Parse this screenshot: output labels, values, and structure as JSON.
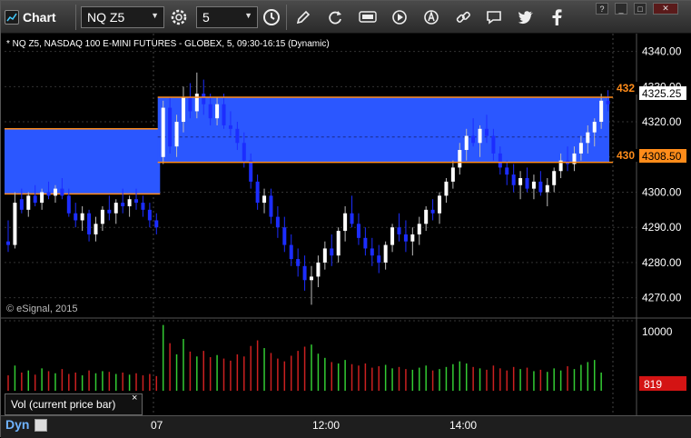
{
  "window": {
    "title": "Chart",
    "controls": [
      "?",
      "_",
      "□",
      "✕"
    ]
  },
  "toolbar": {
    "symbol": "NQ Z5",
    "interval": "5",
    "icons": [
      "settings-gear-icon",
      "clock-icon",
      "draw-pencil-icon",
      "refresh-icon",
      "get-data-icon",
      "play-icon",
      "alert-icon",
      "link-icon",
      "chat-icon",
      "twitter-icon",
      "facebook-icon"
    ]
  },
  "chart": {
    "header": "* NQ Z5, NASDAQ 100 E-MINI FUTURES - GLOBEX, 5, 09:30-16:15 (Dynamic)",
    "copyright": "© eSignal, 2015",
    "price_marker_last": "4325.25",
    "price_marker_top": "432",
    "price_marker_bottom_left": "430",
    "price_marker_bottom": "4308.50",
    "vol_marker": "819",
    "vol_axis_label": "10000",
    "vol_tab_label": "Vol (current price bar)",
    "vol_close": "×",
    "dyn_label": "Dyn",
    "colors": {
      "up": "#ffffff",
      "down": "#1c2dff",
      "band": "#2b57ff",
      "level_line": "#ff8c1a",
      "vol_up": "#33cc33",
      "vol_down": "#cc2020",
      "price_marker_bg": "#ffffff",
      "level_marker_bg": "#ff8c1a",
      "vol_marker_bg": "#d41414"
    }
  },
  "chart_data": {
    "type": "candlestick",
    "title": "NQ Z5, NASDAQ 100 E-MINI FUTURES - GLOBEX, 5, 09:30-16:15 (Dynamic)",
    "ylim": [
      4265,
      4343
    ],
    "yticks": [
      "4340.00",
      "4330.00",
      "4320.00",
      "4310.00",
      "4300.00",
      "4290.00",
      "4280.00",
      "4270.00"
    ],
    "xticks": [
      "07",
      "12:00",
      "14:00"
    ],
    "levels": [
      4327,
      4308.5
    ],
    "prior_band": [
      4299.5,
      4318
    ],
    "bars": [
      [
        4286,
        4292,
        4283,
        4285
      ],
      [
        4285,
        4300,
        4284,
        4297
      ],
      [
        4298,
        4301,
        4294,
        4295
      ],
      [
        4295,
        4300,
        4293,
        4299
      ],
      [
        4299,
        4302,
        4296,
        4297
      ],
      [
        4297,
        4301,
        4295,
        4300
      ],
      [
        4300,
        4303,
        4298,
        4299
      ],
      [
        4299,
        4302,
        4297,
        4301
      ],
      [
        4301,
        4304,
        4298,
        4299
      ],
      [
        4299,
        4301,
        4293,
        4294
      ],
      [
        4294,
        4297,
        4290,
        4292
      ],
      [
        4292,
        4296,
        4289,
        4294
      ],
      [
        4294,
        4295,
        4286,
        4288
      ],
      [
        4288,
        4293,
        4286,
        4291
      ],
      [
        4291,
        4296,
        4289,
        4295
      ],
      [
        4295,
        4299,
        4292,
        4294
      ],
      [
        4294,
        4298,
        4291,
        4297
      ],
      [
        4297,
        4301,
        4294,
        4296
      ],
      [
        4296,
        4299,
        4293,
        4298
      ],
      [
        4298,
        4301,
        4295,
        4297
      ],
      [
        4297,
        4299,
        4293,
        4295
      ],
      [
        4295,
        4297,
        4290,
        4292
      ],
      [
        4292,
        4294,
        4288,
        4290
      ],
      [
        4310,
        4326,
        4308,
        4324
      ],
      [
        4324,
        4327,
        4311,
        4313
      ],
      [
        4313,
        4322,
        4310,
        4320
      ],
      [
        4320,
        4330,
        4317,
        4327
      ],
      [
        4327,
        4331,
        4321,
        4323
      ],
      [
        4323,
        4334,
        4321,
        4328
      ],
      [
        4328,
        4332,
        4322,
        4325
      ],
      [
        4325,
        4328,
        4319,
        4321
      ],
      [
        4321,
        4327,
        4319,
        4325
      ],
      [
        4325,
        4328,
        4318,
        4319
      ],
      [
        4319,
        4323,
        4316,
        4318
      ],
      [
        4318,
        4320,
        4312,
        4314
      ],
      [
        4314,
        4317,
        4307,
        4309
      ],
      [
        4309,
        4311,
        4301,
        4303
      ],
      [
        4303,
        4305,
        4295,
        4297
      ],
      [
        4297,
        4301,
        4294,
        4299
      ],
      [
        4299,
        4301,
        4291,
        4293
      ],
      [
        4293,
        4296,
        4287,
        4290
      ],
      [
        4290,
        4293,
        4283,
        4285
      ],
      [
        4285,
        4288,
        4279,
        4281
      ],
      [
        4281,
        4284,
        4276,
        4279
      ],
      [
        4279,
        4282,
        4272,
        4275
      ],
      [
        4275,
        4279,
        4268,
        4276
      ],
      [
        4276,
        4282,
        4273,
        4280
      ],
      [
        4280,
        4286,
        4278,
        4284
      ],
      [
        4284,
        4288,
        4279,
        4282
      ],
      [
        4282,
        4290,
        4280,
        4289
      ],
      [
        4289,
        4296,
        4286,
        4294
      ],
      [
        4294,
        4299,
        4290,
        4291
      ],
      [
        4291,
        4294,
        4285,
        4287
      ],
      [
        4287,
        4290,
        4282,
        4284
      ],
      [
        4284,
        4287,
        4279,
        4282
      ],
      [
        4282,
        4285,
        4277,
        4280
      ],
      [
        4280,
        4286,
        4278,
        4285
      ],
      [
        4285,
        4291,
        4283,
        4290
      ],
      [
        4290,
        4294,
        4286,
        4288
      ],
      [
        4288,
        4292,
        4283,
        4286
      ],
      [
        4286,
        4290,
        4282,
        4288
      ],
      [
        4288,
        4293,
        4285,
        4291
      ],
      [
        4291,
        4296,
        4289,
        4295
      ],
      [
        4295,
        4298,
        4292,
        4294
      ],
      [
        4294,
        4300,
        4291,
        4299
      ],
      [
        4299,
        4304,
        4297,
        4303
      ],
      [
        4303,
        4309,
        4301,
        4307
      ],
      [
        4307,
        4314,
        4305,
        4312
      ],
      [
        4312,
        4318,
        4309,
        4316
      ],
      [
        4316,
        4321,
        4313,
        4314
      ],
      [
        4314,
        4319,
        4310,
        4318
      ],
      [
        4318,
        4322,
        4314,
        4316
      ],
      [
        4316,
        4318,
        4309,
        4311
      ],
      [
        4311,
        4313,
        4305,
        4307
      ],
      [
        4307,
        4309,
        4302,
        4305
      ],
      [
        4305,
        4308,
        4300,
        4302
      ],
      [
        4302,
        4306,
        4298,
        4304
      ],
      [
        4304,
        4307,
        4300,
        4301
      ],
      [
        4301,
        4305,
        4298,
        4303
      ],
      [
        4303,
        4306,
        4299,
        4300
      ],
      [
        4300,
        4304,
        4296,
        4302
      ],
      [
        4302,
        4307,
        4300,
        4306
      ],
      [
        4306,
        4311,
        4304,
        4309
      ],
      [
        4309,
        4313,
        4306,
        4308
      ],
      [
        4308,
        4313,
        4306,
        4311
      ],
      [
        4311,
        4316,
        4309,
        4314
      ],
      [
        4314,
        4319,
        4311,
        4317
      ],
      [
        4317,
        4321,
        4313,
        4320
      ],
      [
        4320,
        4328,
        4318,
        4326
      ],
      [
        4326,
        4329,
        4323,
        4325
      ]
    ],
    "volume_ylim": [
      0,
      10000
    ],
    "volume": [
      2200,
      3600,
      2600,
      2900,
      2300,
      3200,
      2800,
      2500,
      3100,
      2400,
      2600,
      2200,
      2900,
      2500,
      2800,
      2700,
      2400,
      2600,
      2300,
      2500,
      2200,
      2400,
      2100,
      9400,
      6800,
      5200,
      7400,
      5600,
      4900,
      5700,
      4800,
      5100,
      4600,
      4300,
      5200,
      4900,
      6400,
      7200,
      6100,
      5400,
      4600,
      4200,
      5000,
      5700,
      6300,
      6600,
      5300,
      4700,
      4100,
      3900,
      4400,
      3800,
      3600,
      3900,
      3300,
      3500,
      3700,
      3200,
      3400,
      3100,
      3000,
      3300,
      3600,
      2900,
      3100,
      3400,
      3800,
      4200,
      3900,
      3400,
      3200,
      3000,
      3600,
      3200,
      2900,
      3400,
      3100,
      3300,
      2800,
      3000,
      2700,
      3200,
      2900,
      3500,
      3100,
      3700,
      4100,
      4400,
      2600
    ],
    "volume_last": 819
  }
}
